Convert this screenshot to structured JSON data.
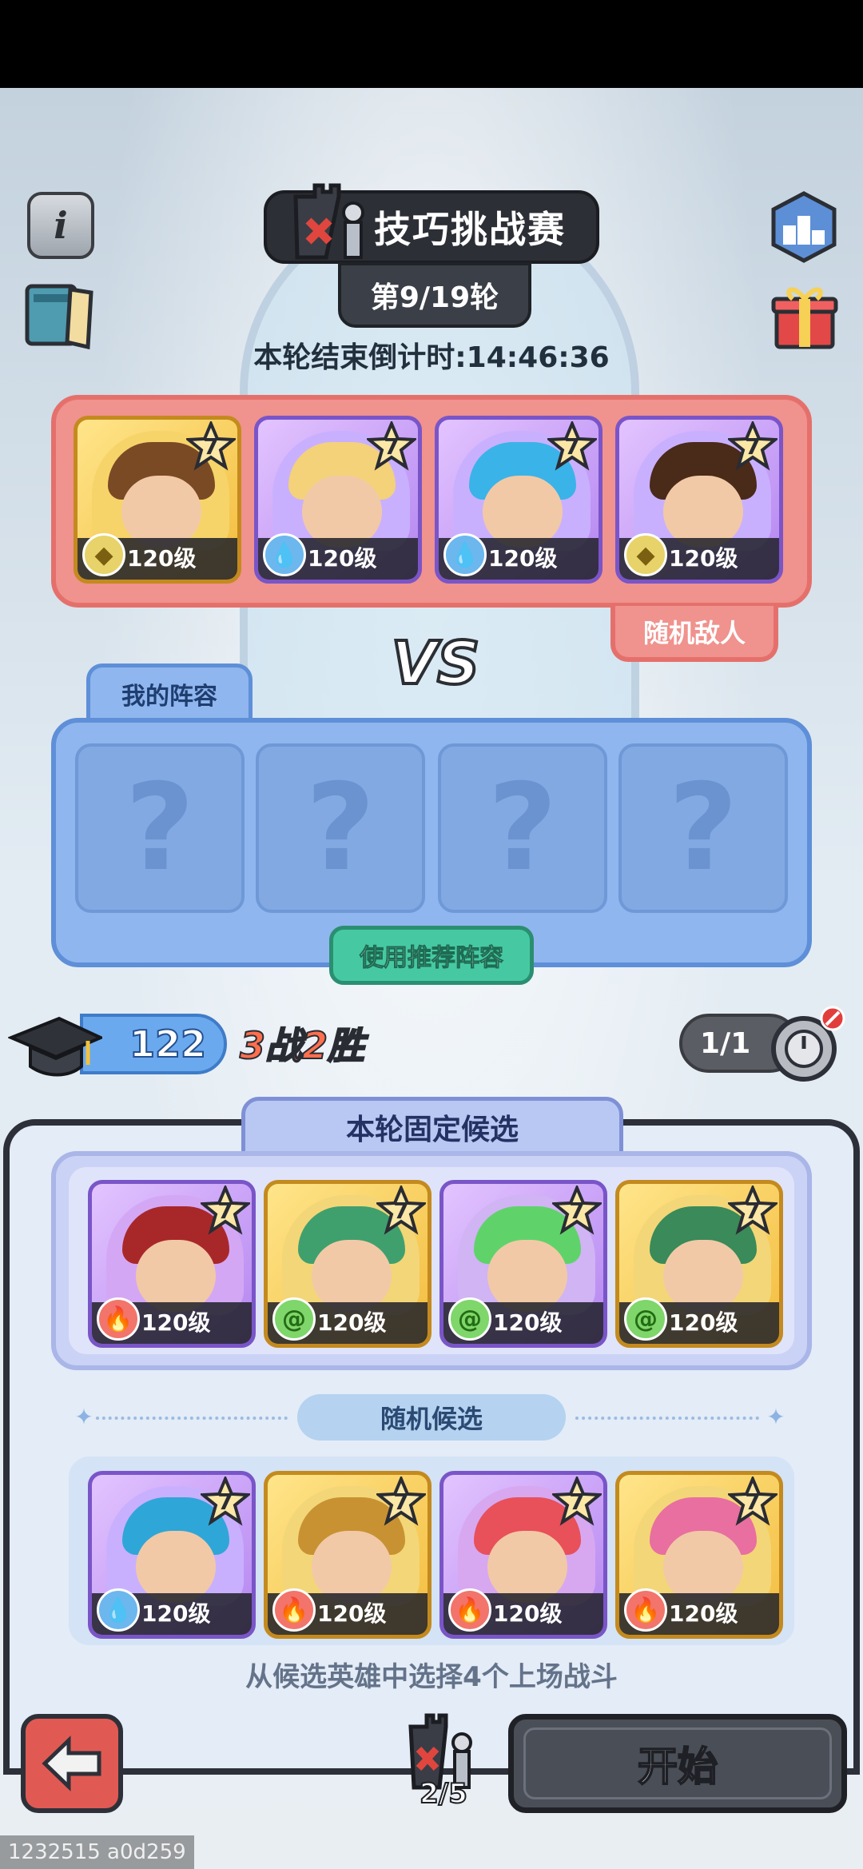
{
  "header": {
    "title": "技巧挑战赛",
    "round": "第9/19轮",
    "countdown": "本轮结束倒计时:14:46:36"
  },
  "enemy": {
    "tag": "随机敌人",
    "heroes": [
      {
        "star": "7",
        "level": "120级",
        "element": "earth",
        "frame": "gold",
        "hair": "#7a4a24",
        "bg": "#f6d46a"
      },
      {
        "star": "7",
        "level": "120级",
        "element": "water",
        "frame": "purple",
        "hair": "#f3d27a",
        "bg": "#c9b0ff"
      },
      {
        "star": "7",
        "level": "120级",
        "element": "water",
        "frame": "purple",
        "hair": "#3ab3e8",
        "bg": "#c9b0ff"
      },
      {
        "star": "7",
        "level": "120级",
        "element": "earth",
        "frame": "purple",
        "hair": "#4a2a18",
        "bg": "#c9b0ff"
      }
    ]
  },
  "vs": "VS",
  "my_lineup": {
    "tab": "我的阵容",
    "slots": [
      "?",
      "?",
      "?",
      "?"
    ],
    "recommend_button": "使用推荐阵容"
  },
  "stats": {
    "score": "122",
    "record": "3战2胜",
    "attempts": "1/1"
  },
  "fixed_candidates": {
    "tab": "本轮固定候选",
    "heroes": [
      {
        "star": "7",
        "level": "120级",
        "element": "fire",
        "frame": "purple",
        "hair": "#a8282a",
        "bg": "#d4a7f4"
      },
      {
        "star": "7",
        "level": "120级",
        "element": "wind",
        "frame": "gold",
        "hair": "#3fa06e",
        "bg": "#f3d678"
      },
      {
        "star": "7",
        "level": "120级",
        "element": "wind",
        "frame": "purple",
        "hair": "#5fd36a",
        "bg": "#d0b4f4"
      },
      {
        "star": "7",
        "level": "120级",
        "element": "wind",
        "frame": "gold",
        "hair": "#3a8a5a",
        "bg": "#f3d678"
      }
    ]
  },
  "random_candidates": {
    "label": "随机候选",
    "heroes": [
      {
        "star": "7",
        "level": "120级",
        "element": "water",
        "frame": "purple",
        "hair": "#2fa6d8",
        "bg": "#c9b0ff"
      },
      {
        "star": "7",
        "level": "120级",
        "element": "fire",
        "frame": "gold",
        "hair": "#c89232",
        "bg": "#f3d678"
      },
      {
        "star": "7",
        "level": "120级",
        "element": "fire",
        "frame": "purple",
        "hair": "#e8505a",
        "bg": "#d7a8f0"
      },
      {
        "star": "7",
        "level": "120级",
        "element": "fire",
        "frame": "gold",
        "hair": "#e86fa0",
        "bg": "#f3d678"
      }
    ]
  },
  "hint": "从候选英雄中选择4个上场战斗",
  "footer": {
    "challenge_count": "2/5",
    "start_button": "开始"
  },
  "build_id": "1232515 a0d259",
  "colors": {
    "enemy_panel": "#f0928d",
    "my_panel": "#8fb6ee",
    "accent_green": "#46c9a2",
    "back_red": "#e05a53"
  }
}
